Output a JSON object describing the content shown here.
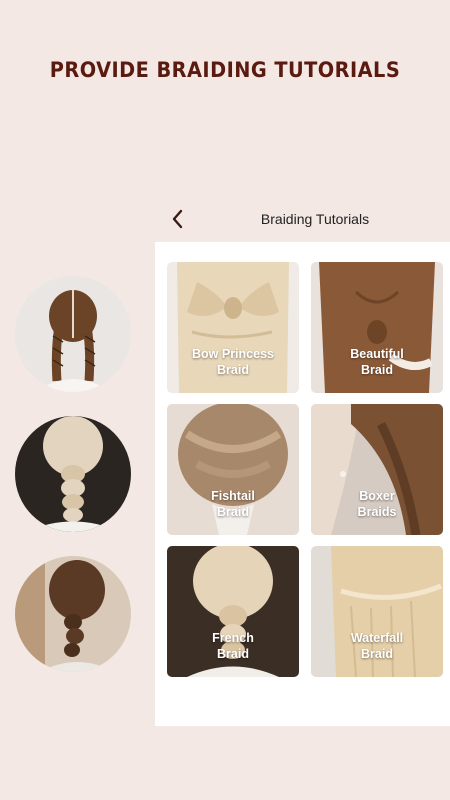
{
  "headline": "PROVIDE BRAIDING TUTORIALS",
  "header": {
    "title": "Braiding Tutorials",
    "back_icon": "chevron-left-icon"
  },
  "colors": {
    "background": "#f3e8e3",
    "headline": "#5b1a10",
    "panel": "#ffffff"
  },
  "cards": [
    {
      "label": "Bow Princess\nBraid"
    },
    {
      "label": "Beautiful\nBraid"
    },
    {
      "label": "Fishtail\nBraid"
    },
    {
      "label": "Boxer\nBraids"
    },
    {
      "label": "French\nBraid"
    },
    {
      "label": "Waterfall\nBraid"
    }
  ]
}
